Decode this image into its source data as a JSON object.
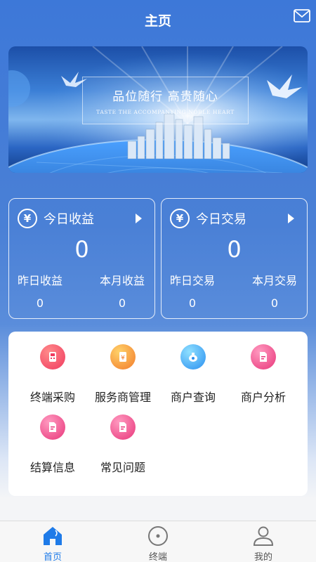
{
  "header": {
    "title": "主页",
    "mail_icon": "mail-icon"
  },
  "banner": {
    "title_cn": "品位随行  高贵随心",
    "subtitle_en": "TASTE THE ACCOMPANYING NOBLE HEART"
  },
  "income_card": {
    "icon": "yen-icon",
    "title": "今日收益",
    "value": "0",
    "sub": [
      {
        "label": "昨日收益",
        "value": "0"
      },
      {
        "label": "本月收益",
        "value": "0"
      }
    ]
  },
  "trade_card": {
    "icon": "yen-icon",
    "title": "今日交易",
    "value": "0",
    "sub": [
      {
        "label": "昨日交易",
        "value": "0"
      },
      {
        "label": "本月交易",
        "value": "0"
      }
    ]
  },
  "menu": [
    {
      "label": "终端采购",
      "icon": "terminal-icon",
      "color": "#f03a5f"
    },
    {
      "label": "服务商管理",
      "icon": "yen-doc-icon",
      "color": "#f6a02a"
    },
    {
      "label": "商户查询",
      "icon": "moneybag-icon",
      "color": "#3aa4f0"
    },
    {
      "label": "商户分析",
      "icon": "document-icon",
      "color": "#ee4a8a"
    },
    {
      "label": "结算信息",
      "icon": "document-icon",
      "color": "#ee4a8a"
    },
    {
      "label": "常见问题",
      "icon": "document-icon",
      "color": "#ee4a8a"
    }
  ],
  "bottom_nav": {
    "items": [
      {
        "label": "首页",
        "icon": "home-icon",
        "active": true
      },
      {
        "label": "终端",
        "icon": "compass-icon",
        "active": false
      },
      {
        "label": "我的",
        "icon": "user-icon",
        "active": false
      }
    ],
    "active_color": "#1f7be8"
  }
}
